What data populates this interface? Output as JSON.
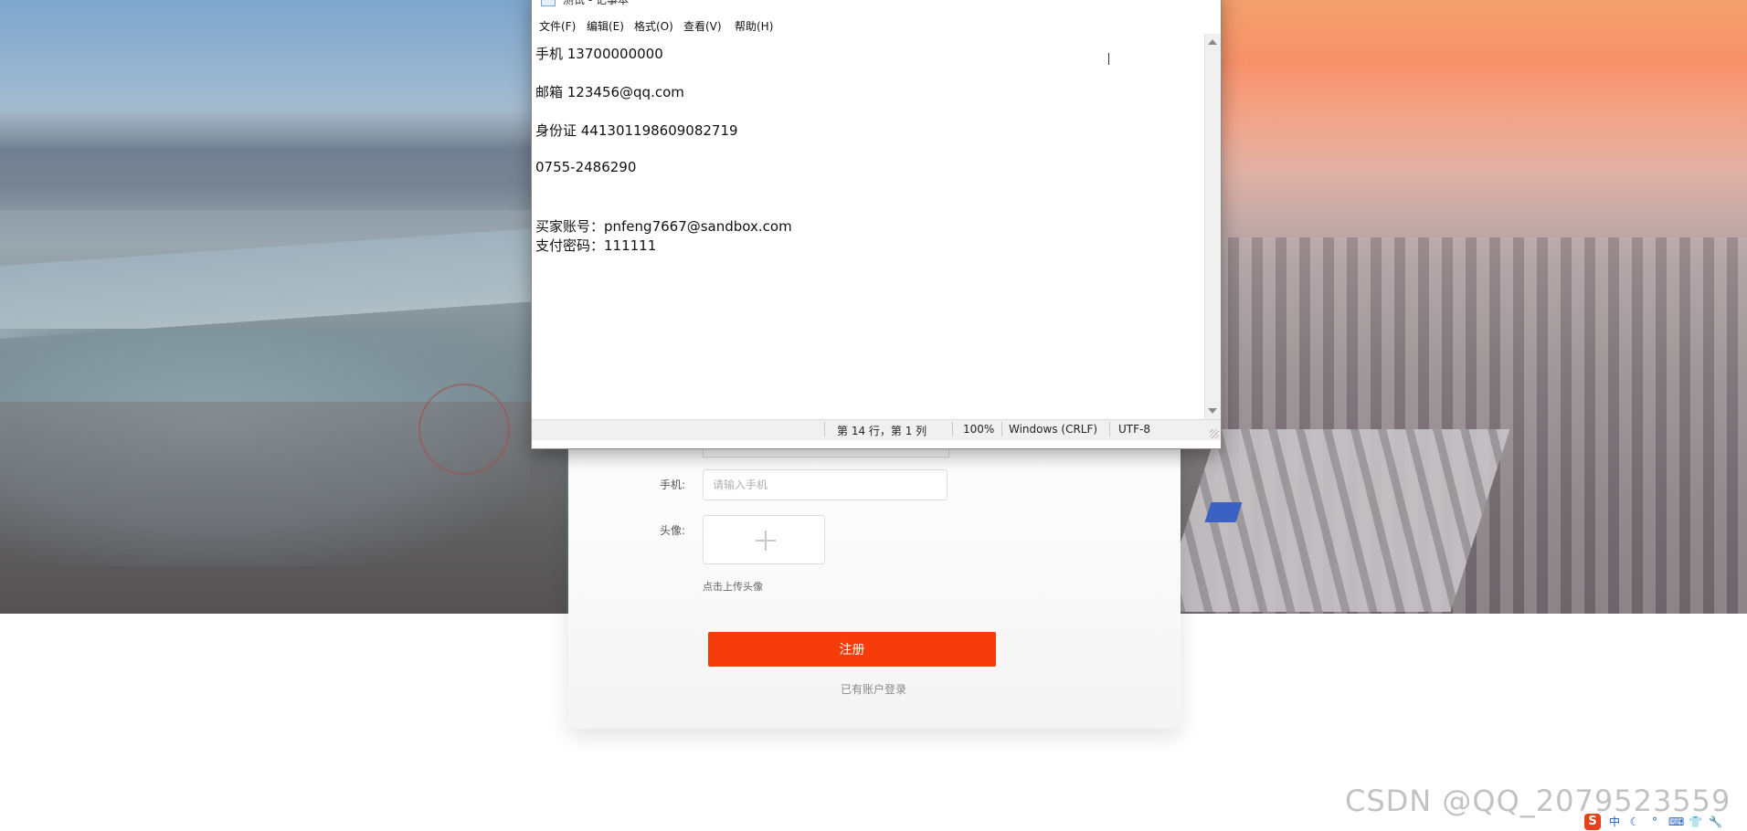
{
  "notepad": {
    "title": "测试 - 记事本",
    "menu": [
      "文件(F)",
      "编辑(E)",
      "格式(O)",
      "查看(V)",
      "帮助(H)"
    ],
    "lines": [
      "手机 13700000000",
      "邮箱 123456@qq.com",
      "身份证 441301198609082719",
      "0755-2486290",
      "买家账号：pnfeng7667@sandbox.com",
      "支付密码：111111"
    ],
    "status": {
      "position": "第 14 行，第 1 列",
      "zoom": "100%",
      "line_ending": "Windows (CRLF)",
      "encoding": "UTF-8"
    },
    "controls": {
      "minimize": "—",
      "maximize": "☐",
      "close": "✕"
    }
  },
  "form": {
    "phone_label": "手机:",
    "phone_placeholder": "请输入手机",
    "avatar_label": "头像:",
    "upload_hint": "点击上传头像",
    "register_label": "注册",
    "login_link": "已有账户登录"
  },
  "watermark": "CSDN @QQ_2079523559",
  "tray": {
    "logo": "S",
    "items": [
      "中",
      "☾",
      "°",
      "⌨",
      "👕",
      "🔧"
    ]
  },
  "colors": {
    "register_button": "#f63c0a"
  }
}
